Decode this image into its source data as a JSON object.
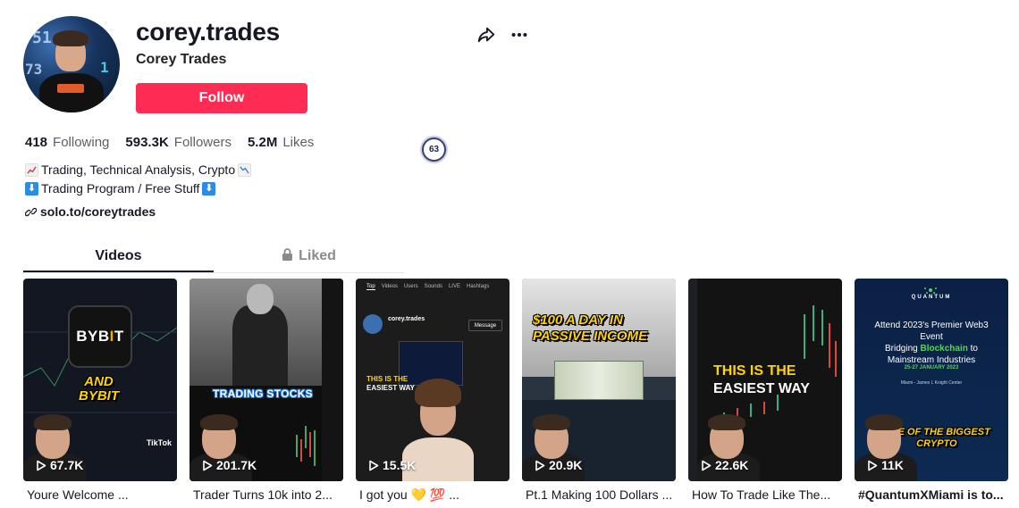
{
  "profile": {
    "username": "corey.trades",
    "nickname": "Corey Trades",
    "follow_label": "Follow",
    "stats": {
      "following_count": "418",
      "following_label": "Following",
      "followers_count": "593.3K",
      "followers_label": "Followers",
      "likes_count": "5.2M",
      "likes_label": "Likes"
    },
    "bio": {
      "line1": "Trading, Technical Analysis, Crypto",
      "line2": "Trading Program / Free Stuff"
    },
    "link": "solo.to/coreytrades",
    "badge_count": "63"
  },
  "tabs": {
    "videos": "Videos",
    "liked": "Liked"
  },
  "colors": {
    "follow_button": "#fe2c55",
    "text_primary": "#161823",
    "text_secondary": "#5c5f66"
  },
  "videos": [
    {
      "views": "67.7K",
      "caption": "Youre Welcome ...",
      "thumb": {
        "logo_main": "BYB",
        "logo_accent": "I",
        "logo_end": "T",
        "overlay_1": "AND",
        "overlay_2": "BYBIT",
        "watermark": "TikTok"
      }
    },
    {
      "views": "201.7K",
      "caption": "Trader Turns 10k into 2...",
      "thumb": {
        "overlay": "TRADING STOCKS"
      }
    },
    {
      "views": "15.5K",
      "caption": "I got you 💛 💯 ...",
      "thumb": {
        "tabs": [
          "Top",
          "Videos",
          "Users",
          "Sounds",
          "LIVE",
          "Hashtags"
        ],
        "handle": "corey.trades",
        "message_label": "Message",
        "easy_1": "THIS IS THE",
        "easy_2": "EASIEST WAY"
      }
    },
    {
      "views": "20.9K",
      "caption": "Pt.1 Making 100 Dollars ...",
      "thumb": {
        "overlay_1": "$100 A DAY IN",
        "overlay_2": "PASSIVE INCOME"
      }
    },
    {
      "views": "22.6K",
      "caption": "How To Trade Like The...",
      "thumb": {
        "line_1": "THIS IS THE",
        "line_2": "EASIEST WAY"
      }
    },
    {
      "views": "11K",
      "caption": "#QuantumXMiami is to...",
      "thumb": {
        "brand": "QUANTUM",
        "event_line_1": "Attend 2023's Premier Web3",
        "event_line_2": "Event",
        "event_line_3a": "Bridging ",
        "event_line_3b": "Blockchain",
        "event_line_3c": " to",
        "event_line_4": "Mainstream Industries",
        "dates": "25-27 JANUARY 2023",
        "location": "Miami - James L Knight Center",
        "overlay_1": "ONE OF THE BIGGEST",
        "overlay_2": "CRYPTO"
      }
    }
  ]
}
